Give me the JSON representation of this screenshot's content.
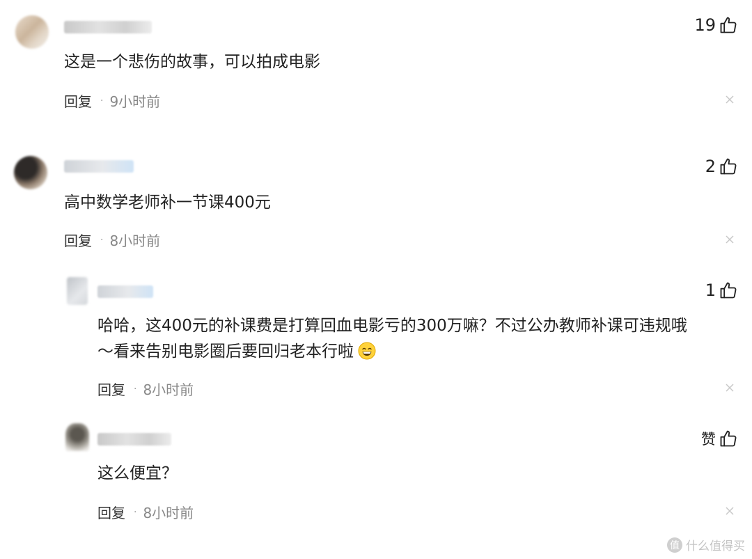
{
  "comments": [
    {
      "likes": "19",
      "text": "这是一个悲伤的故事，可以拍成电影",
      "reply_label": "回复",
      "time": "9小时前"
    },
    {
      "likes": "2",
      "text": "高中数学老师补一节课400元",
      "reply_label": "回复",
      "time": "8小时前"
    },
    {
      "likes": "1",
      "text_line1": "哈哈，这400元的补课费是打算回血电影亏的300万嘛？不过公办教师补课可违规哦",
      "text_line2": "～看来告别电影圈后要回归老本行啦",
      "emoji": "grinning-emoji",
      "reply_label": "回复",
      "time": "8小时前"
    },
    {
      "likes": "赞",
      "text": "这么便宜？",
      "reply_label": "回复",
      "time": "8小时前"
    }
  ],
  "separator": "·",
  "watermark": {
    "icon_text": "值",
    "label": "什么值得买"
  },
  "colors": {
    "text": "#222222",
    "meta": "#888888",
    "watermark": "#c4c4c4"
  }
}
